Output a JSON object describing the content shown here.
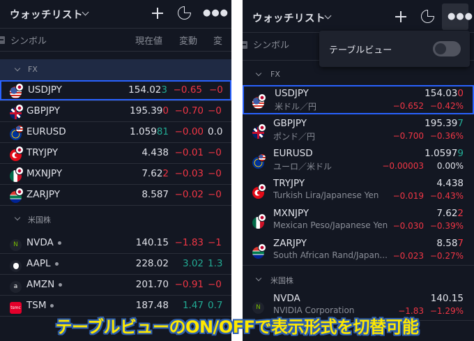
{
  "header": {
    "title": "ウォッチリスト"
  },
  "left": {
    "columns": {
      "symbol": "シンボル",
      "last": "現在値",
      "change": "変動",
      "change_pct": "変"
    },
    "sections": [
      {
        "name": "FX",
        "rows": [
          {
            "symbol": "USDJPY",
            "last_main": "154.02",
            "last_tail": "3",
            "tail_dir": "up",
            "change": "−0.65",
            "change_dir": "dn",
            "pct": "−0",
            "pct_dir": "dn"
          },
          {
            "symbol": "GBPJPY",
            "last_main": "195.39",
            "last_tail": "0",
            "tail_dir": "dn",
            "change": "−0.70",
            "change_dir": "dn",
            "pct": "−0",
            "pct_dir": "dn"
          },
          {
            "symbol": "EURUSD",
            "last_main": "1.059",
            "last_tail": "81",
            "tail_dir": "up",
            "change": "−0.00",
            "change_dir": "dn",
            "pct": "0.0",
            "pct_dir": "wh"
          },
          {
            "symbol": "TRYJPY",
            "last_main": "4.438",
            "last_tail": "",
            "tail_dir": "wh",
            "change": "−0.01",
            "change_dir": "dn",
            "pct": "−0",
            "pct_dir": "dn"
          },
          {
            "symbol": "MXNJPY",
            "last_main": "7.62",
            "last_tail": "2",
            "tail_dir": "dn",
            "change": "−0.03",
            "change_dir": "dn",
            "pct": "−0",
            "pct_dir": "dn"
          },
          {
            "symbol": "ZARJPY",
            "last_main": "8.587",
            "last_tail": "",
            "tail_dir": "wh",
            "change": "−0.02",
            "change_dir": "dn",
            "pct": "−0",
            "pct_dir": "dn"
          }
        ]
      },
      {
        "name": "米国株",
        "rows": [
          {
            "symbol": "NVDA",
            "last_main": "140.15",
            "last_tail": "",
            "tail_dir": "wh",
            "change": "−1.83",
            "change_dir": "dn",
            "pct": "−1",
            "pct_dir": "dn"
          },
          {
            "symbol": "AAPL",
            "last_main": "228.02",
            "last_tail": "",
            "tail_dir": "wh",
            "change": "3.02",
            "change_dir": "up",
            "pct": "1.3",
            "pct_dir": "up"
          },
          {
            "symbol": "AMZN",
            "last_main": "201.70",
            "last_tail": "",
            "tail_dir": "wh",
            "change": "−0.91",
            "change_dir": "dn",
            "pct": "−0",
            "pct_dir": "dn"
          },
          {
            "symbol": "TSM",
            "last_main": "187.48",
            "last_tail": "",
            "tail_dir": "wh",
            "change": "1.47",
            "change_dir": "up",
            "pct": "0.7",
            "pct_dir": "up"
          }
        ]
      }
    ]
  },
  "right": {
    "columns": {
      "symbol": "シンボル"
    },
    "menu": {
      "table_view_label": "テーブルビュー",
      "table_view_on": false
    },
    "sections": [
      {
        "name": "FX",
        "rows": [
          {
            "symbol": "USDJPY",
            "desc": "米ドル／円",
            "last_main": "154.03",
            "last_tail": "0",
            "tail_dir": "dn",
            "change": "−0.652",
            "pct": "−0.42%",
            "change_dir": "dn",
            "pct_dir": "dn"
          },
          {
            "symbol": "GBPJPY",
            "desc": "ポンド／円",
            "last_main": "195.39",
            "last_tail": "7",
            "tail_dir": "up",
            "change": "−0.700",
            "pct": "−0.36%",
            "change_dir": "dn",
            "pct_dir": "dn"
          },
          {
            "symbol": "EURUSD",
            "desc": "ユーロ／米ドル",
            "last_main": "1.0597",
            "last_tail": "9",
            "tail_dir": "up",
            "change": "−0.00003",
            "pct": "0.00%",
            "change_dir": "dn",
            "pct_dir": "wh"
          },
          {
            "symbol": "TRYJPY",
            "desc": "Turkish Lira/Japanese Yen",
            "last_main": "4.438",
            "last_tail": "",
            "tail_dir": "wh",
            "change": "−0.019",
            "pct": "−0.43%",
            "change_dir": "dn",
            "pct_dir": "dn"
          },
          {
            "symbol": "MXNJPY",
            "desc": "Mexican Peso/Japanese Yen",
            "last_main": "7.62",
            "last_tail": "2",
            "tail_dir": "dn",
            "change": "−0.030",
            "pct": "−0.39%",
            "change_dir": "dn",
            "pct_dir": "dn"
          },
          {
            "symbol": "ZARJPY",
            "desc": "South African Rand/Japan...",
            "last_main": "8.58",
            "last_tail": "7",
            "tail_dir": "dn",
            "change": "−0.023",
            "pct": "−0.27%",
            "change_dir": "dn",
            "pct_dir": "dn"
          }
        ]
      },
      {
        "name": "米国株",
        "rows": [
          {
            "symbol": "NVDA",
            "desc": "NVIDIA Corporation",
            "last_main": "140.15",
            "last_tail": "",
            "tail_dir": "wh",
            "change": "−1.83",
            "pct": "−1.29%",
            "change_dir": "dn",
            "pct_dir": "dn"
          }
        ]
      }
    ]
  },
  "caption": "テーブルビューのON/OFFで表示形式を切替可能",
  "colors": {
    "background": "#131722",
    "selected_border": "#2962ff",
    "up": "#22ab94",
    "down": "#f23645",
    "caption": "#ffe800",
    "caption_outline": "#2d5fb0"
  },
  "icons": [
    "plus-icon",
    "pie-chart-icon",
    "more-icon",
    "chevron-down-icon"
  ]
}
